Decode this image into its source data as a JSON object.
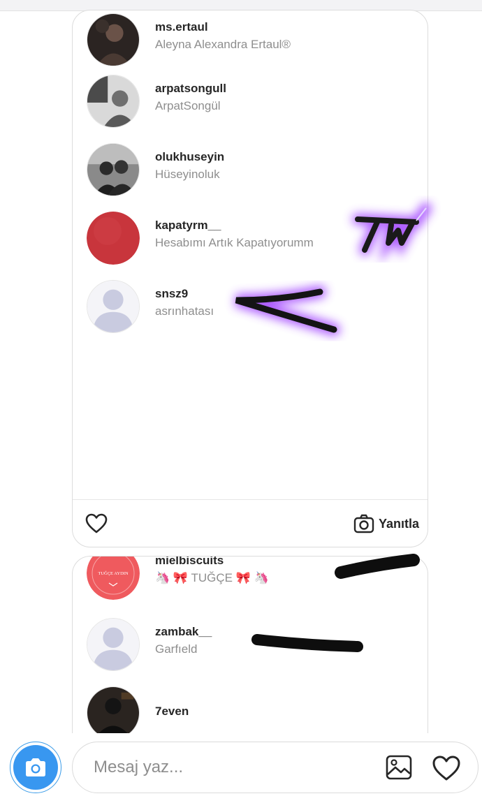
{
  "story_viewers": [
    {
      "username": "ms.ertaul",
      "full_name": "Aleyna Alexandra Ertaul®",
      "avatar": "photo-dark"
    },
    {
      "username": "arpatsongull",
      "full_name": "ArpatSongül",
      "avatar": "photo-gray"
    },
    {
      "username": "olukhuseyin",
      "full_name": "Hüseyinoluk",
      "avatar": "photo-couple"
    },
    {
      "username": "kapatyrm__",
      "full_name": "Hesabımı Artık Kapatıyorumm",
      "avatar": "red-circle"
    },
    {
      "username": "snsz9",
      "full_name": "asrınhatası",
      "avatar": "default-silhouette"
    }
  ],
  "card_footer": {
    "reply_label": "Yanıtla"
  },
  "story_viewers_2": [
    {
      "username": "mielbiscuits",
      "full_name": "🦄 🎀 TUĞÇE 🎀 🦄",
      "avatar": "logo-red",
      "avatar_text": "TUĞÇE AYDIN"
    },
    {
      "username": "zambak__",
      "full_name": "Garfıeld",
      "avatar": "default-silhouette"
    },
    {
      "username": "7even",
      "full_name": "",
      "avatar": "photo-dark"
    }
  ],
  "composer": {
    "placeholder": "Mesaj yaz..."
  },
  "colors": {
    "accent": "#3897f0",
    "red_avatar": "#c8353c",
    "silhouette": "#c9cbe0",
    "neon": "#a64dff"
  },
  "icons": [
    "heart-icon",
    "camera-icon",
    "gallery-icon"
  ]
}
